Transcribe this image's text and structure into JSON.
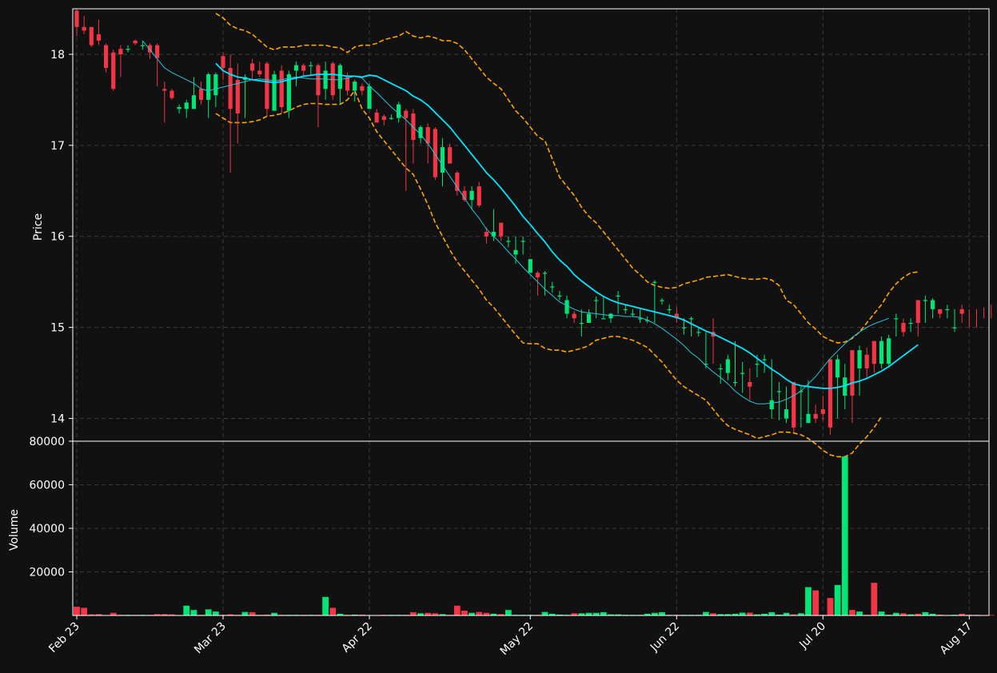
{
  "chart_data": {
    "type": "candlestick",
    "colors": {
      "background": "#111111",
      "up": "#00e676",
      "down": "#f23645",
      "ma_slow": "#00e5ff",
      "ma_fast": "#26c6da",
      "bollinger": "#ffa500",
      "grid": "#3a3a3a",
      "axis": "#ffffff",
      "text": "#ffffff"
    },
    "price_panel": {
      "ylabel": "Price",
      "ylim": [
        13.75,
        18.5
      ],
      "yticks": [
        14,
        15,
        16,
        17,
        18
      ],
      "grid": true
    },
    "volume_panel": {
      "ylabel": "Volume",
      "ylim": [
        0,
        80000
      ],
      "yticks": [
        20000,
        40000,
        60000,
        80000
      ],
      "grid": true
    },
    "x_tick_labels": [
      {
        "label": "Feb 23",
        "index": 0
      },
      {
        "label": "Mar 23",
        "index": 20
      },
      {
        "label": "Apr 22",
        "index": 40
      },
      {
        "label": "May 22",
        "index": 62
      },
      {
        "label": "Jun 22",
        "index": 82
      },
      {
        "label": "Jul 20",
        "index": 102
      },
      {
        "label": "Aug 17",
        "index": 122
      }
    ],
    "candle_count": 126,
    "close": [
      18.3,
      18.26,
      18.1,
      18.15,
      17.85,
      17.62,
      18.0,
      18.06,
      18.12,
      18.1,
      18.02,
      17.96,
      17.6,
      17.52,
      17.42,
      17.47,
      17.55,
      17.5,
      17.78,
      17.78,
      17.85,
      17.4,
      17.35,
      17.75,
      17.82,
      17.78,
      17.4,
      17.78,
      17.42,
      17.78,
      17.88,
      17.82,
      17.88,
      17.55,
      17.82,
      17.55,
      17.88,
      17.6,
      17.7,
      17.6,
      17.65,
      17.25,
      17.28,
      17.3,
      17.45,
      17.3,
      17.06,
      17.2,
      17.02,
      16.65,
      16.98,
      16.8,
      16.5,
      16.4,
      16.5,
      16.34,
      16.0,
      16.05,
      16.0,
      15.95,
      15.85,
      15.95,
      15.75,
      15.55,
      15.6,
      15.45,
      15.35,
      15.3,
      15.1,
      15.05,
      15.15,
      15.3,
      15.1,
      15.15,
      15.35,
      15.2,
      15.15,
      15.1,
      15.08,
      15.5,
      15.3,
      15.2,
      15.1,
      15.0,
      15.1,
      14.95,
      14.6,
      14.9,
      14.55,
      14.65,
      14.4,
      14.5,
      14.35,
      14.6,
      14.65,
      14.2,
      14.3,
      14.1,
      13.9,
      14.3,
      14.05,
      14.0,
      14.05,
      13.9,
      14.65,
      14.45,
      14.25,
      14.75,
      14.55,
      14.6,
      14.85,
      14.88,
      15.1,
      14.95,
      15.05,
      15.05,
      15.3,
      15.3,
      15.15,
      15.2,
      15.0,
      15.15,
      15.15,
      15.1,
      15.2,
      15.2
    ],
    "series": [
      {
        "name": "ohlc_open",
        "values": [
          18.48,
          18.3,
          18.3,
          18.22,
          18.1,
          18.02,
          18.06,
          18.06,
          18.15,
          18.1,
          18.1,
          18.1,
          17.62,
          17.6,
          17.4,
          17.4,
          17.4,
          17.62,
          17.5,
          17.55,
          17.98,
          17.85,
          17.72,
          17.72,
          17.9,
          17.82,
          17.9,
          17.38,
          17.82,
          17.38,
          17.82,
          17.88,
          17.88,
          17.88,
          17.62,
          17.9,
          17.62,
          17.75,
          17.6,
          17.65,
          17.4,
          17.36,
          17.32,
          17.3,
          17.3,
          17.38,
          17.35,
          17.08,
          17.2,
          17.18,
          16.7,
          16.98,
          16.7,
          16.5,
          16.4,
          16.55,
          16.05,
          16.0,
          16.15,
          15.95,
          15.8,
          15.95,
          15.6,
          15.6,
          15.6,
          15.45,
          15.35,
          15.15,
          15.15,
          15.05,
          15.05,
          15.3,
          15.1,
          15.1,
          15.35,
          15.2,
          15.15,
          15.1,
          15.08,
          15.5,
          15.3,
          15.2,
          15.15,
          15.0,
          15.1,
          14.95,
          14.6,
          14.95,
          14.55,
          14.5,
          14.4,
          14.5,
          14.4,
          14.6,
          14.65,
          14.1,
          14.3,
          14.0,
          14.4,
          14.3,
          13.95,
          14.05,
          14.1,
          14.65,
          14.45,
          14.25,
          14.75,
          14.55,
          14.7,
          14.85,
          14.6,
          14.6,
          15.1,
          15.05,
          15.05,
          15.3,
          15.3,
          15.2,
          15.2,
          15.2,
          15.0,
          15.2
        ]
      },
      {
        "name": "ohlc_high",
        "values": [
          18.5,
          18.42,
          18.3,
          18.38,
          18.12,
          18.05,
          18.1,
          18.1,
          18.16,
          18.15,
          18.12,
          18.12,
          17.7,
          17.62,
          17.45,
          17.5,
          17.75,
          17.7,
          17.8,
          17.8,
          18.02,
          18.0,
          17.9,
          17.78,
          17.95,
          17.92,
          17.92,
          17.82,
          17.88,
          17.82,
          17.92,
          17.9,
          17.92,
          17.9,
          17.92,
          17.92,
          17.9,
          17.8,
          17.72,
          17.68,
          17.68,
          17.4,
          17.34,
          17.34,
          17.48,
          17.4,
          17.4,
          17.22,
          17.24,
          17.2,
          17.08,
          17.02,
          16.72,
          16.55,
          16.55,
          16.6,
          16.1,
          16.3,
          16.15,
          16.0,
          16.0,
          16.0,
          15.62,
          15.62,
          15.62,
          15.5,
          15.4,
          15.35,
          15.18,
          15.2,
          15.2,
          15.34,
          15.35,
          15.16,
          15.4,
          15.25,
          15.2,
          15.2,
          15.12,
          15.52,
          15.32,
          15.25,
          15.22,
          15.1,
          15.12,
          15.0,
          14.95,
          15.1,
          14.6,
          14.7,
          14.85,
          14.62,
          14.55,
          14.7,
          14.7,
          14.65,
          14.4,
          14.35,
          14.2,
          14.35,
          14.42,
          14.15,
          14.25,
          14.1,
          14.7,
          14.6,
          14.3,
          14.8,
          14.78,
          14.75,
          14.9,
          14.92,
          15.15,
          15.1,
          15.1,
          15.1,
          15.35,
          15.32,
          15.2,
          15.25,
          15.2,
          15.25,
          15.2,
          15.2,
          15.22,
          15.25
        ]
      },
      {
        "name": "ohlc_low",
        "values": [
          18.2,
          18.22,
          18.08,
          18.1,
          17.8,
          17.6,
          17.75,
          18.02,
          18.1,
          18.05,
          17.95,
          17.65,
          17.25,
          17.5,
          17.35,
          17.3,
          17.4,
          17.45,
          17.3,
          17.42,
          17.72,
          16.7,
          17.02,
          17.3,
          17.72,
          17.75,
          17.32,
          17.38,
          17.35,
          17.3,
          17.65,
          17.75,
          17.78,
          17.2,
          17.5,
          17.5,
          17.45,
          17.55,
          17.48,
          17.55,
          17.58,
          17.28,
          17.22,
          17.28,
          17.25,
          16.5,
          16.8,
          17.02,
          16.8,
          16.62,
          16.55,
          16.8,
          16.45,
          16.38,
          16.3,
          16.32,
          15.92,
          15.95,
          15.95,
          15.88,
          15.7,
          15.8,
          15.7,
          15.35,
          15.35,
          15.38,
          15.3,
          15.1,
          15.05,
          14.9,
          15.05,
          15.1,
          15.1,
          15.05,
          15.15,
          15.15,
          15.12,
          15.05,
          15.05,
          15.05,
          15.25,
          15.15,
          15.05,
          14.92,
          14.9,
          14.9,
          14.55,
          14.6,
          14.38,
          14.42,
          14.35,
          14.28,
          14.2,
          14.45,
          14.5,
          14.0,
          13.98,
          13.95,
          13.85,
          13.9,
          13.95,
          13.95,
          13.98,
          13.82,
          14.0,
          14.1,
          13.95,
          14.25,
          14.45,
          14.5,
          14.55,
          14.58,
          14.9,
          14.9,
          14.95,
          14.9,
          15.05,
          15.1,
          15.1,
          15.1,
          14.95,
          15.05,
          15.0,
          15.0,
          15.1,
          15.1
        ]
      },
      {
        "name": "volume",
        "values": [
          4000,
          3500,
          500,
          600,
          200,
          1200,
          300,
          300,
          300,
          300,
          300,
          600,
          600,
          500,
          200,
          4500,
          2500,
          300,
          2800,
          1800,
          300,
          500,
          300,
          1600,
          1500,
          300,
          400,
          1200,
          300,
          300,
          300,
          300,
          300,
          300,
          8500,
          3500,
          800,
          300,
          400,
          400,
          200,
          200,
          300,
          300,
          300,
          300,
          1500,
          1000,
          1200,
          1000,
          600,
          300,
          4500,
          2200,
          1200,
          1600,
          1200,
          800,
          600,
          2500,
          300,
          300,
          300,
          300,
          1600,
          800,
          400,
          300,
          1000,
          1000,
          1200,
          1200,
          1500,
          500,
          500,
          300,
          300,
          300,
          800,
          1200,
          1500,
          300,
          300,
          300,
          300,
          300,
          1600,
          1000,
          600,
          600,
          800,
          1300,
          1300,
          500,
          800,
          1500,
          400,
          1200,
          500,
          1000,
          13000,
          11500,
          300,
          8000,
          14000,
          73000,
          2500,
          1800,
          300,
          15000,
          1800,
          300,
          1200,
          1000,
          500,
          800,
          1500,
          800,
          400,
          200,
          300,
          800,
          300,
          300,
          200,
          200
        ]
      },
      {
        "name": "ma_slow",
        "values": [
          null,
          null,
          null,
          null,
          null,
          null,
          null,
          null,
          null,
          null,
          null,
          null,
          null,
          null,
          null,
          null,
          null,
          null,
          null,
          17.9,
          17.82,
          17.78,
          17.75,
          17.74,
          17.72,
          17.71,
          17.7,
          17.69,
          17.7,
          17.72,
          17.74,
          17.76,
          17.77,
          17.78,
          17.78,
          17.78,
          17.77,
          17.76,
          17.76,
          17.75,
          17.77,
          17.76,
          17.72,
          17.68,
          17.64,
          17.6,
          17.54,
          17.5,
          17.44,
          17.36,
          17.28,
          17.2,
          17.1,
          17.0,
          16.9,
          16.8,
          16.7,
          16.62,
          16.53,
          16.43,
          16.33,
          16.22,
          16.13,
          16.03,
          15.94,
          15.83,
          15.74,
          15.67,
          15.58,
          15.51,
          15.45,
          15.39,
          15.34,
          15.3,
          15.27,
          15.25,
          15.23,
          15.21,
          15.19,
          15.17,
          15.15,
          15.13,
          15.11,
          15.08,
          15.04,
          15.0,
          14.96,
          14.93,
          14.89,
          14.85,
          14.81,
          14.77,
          14.72,
          14.66,
          14.6,
          14.54,
          14.49,
          14.43,
          14.38,
          14.36,
          14.35,
          14.34,
          14.33,
          14.33,
          14.34,
          14.36,
          14.39,
          14.41,
          14.44,
          14.48,
          14.52,
          14.57,
          14.63,
          14.69,
          14.75,
          14.81
        ]
      },
      {
        "name": "ma_fast",
        "values": [
          null,
          null,
          null,
          null,
          null,
          null,
          null,
          null,
          null,
          18.15,
          18.05,
          17.95,
          17.85,
          17.8,
          17.76,
          17.72,
          17.68,
          17.62,
          17.6,
          17.62,
          17.64,
          17.66,
          17.68,
          17.7,
          17.72,
          17.73,
          17.72,
          17.71,
          17.72,
          17.74,
          17.75,
          17.74,
          17.73,
          17.73,
          17.73,
          17.72,
          17.72,
          17.74,
          17.76,
          17.74,
          17.65,
          17.58,
          17.5,
          17.42,
          17.35,
          17.28,
          17.2,
          17.12,
          17.02,
          16.9,
          16.78,
          16.66,
          16.54,
          16.42,
          16.3,
          16.2,
          16.08,
          16.0,
          15.92,
          15.83,
          15.75,
          15.66,
          15.58,
          15.5,
          15.42,
          15.35,
          15.28,
          15.24,
          15.2,
          15.17,
          15.16,
          15.15,
          15.14,
          15.13,
          15.13,
          15.12,
          15.12,
          15.11,
          15.08,
          15.04,
          14.99,
          14.93,
          14.87,
          14.8,
          14.72,
          14.66,
          14.58,
          14.51,
          14.45,
          14.38,
          14.3,
          14.24,
          14.19,
          14.16,
          14.16,
          14.17,
          14.18,
          14.21,
          14.25,
          14.3,
          14.38,
          14.46,
          14.56,
          14.66,
          14.74,
          14.82,
          14.89,
          14.95,
          15.0,
          15.04,
          15.07,
          15.1
        ]
      },
      {
        "name": "bb_upper",
        "values": [
          null,
          null,
          null,
          null,
          null,
          null,
          null,
          null,
          null,
          null,
          null,
          null,
          null,
          null,
          null,
          null,
          null,
          null,
          null,
          18.45,
          18.4,
          18.32,
          18.28,
          18.26,
          18.22,
          18.15,
          18.08,
          18.05,
          18.08,
          18.08,
          18.08,
          18.1,
          18.1,
          18.1,
          18.1,
          18.08,
          18.07,
          18.02,
          18.08,
          18.1,
          18.1,
          18.12,
          18.16,
          18.18,
          18.2,
          18.25,
          18.2,
          18.18,
          18.2,
          18.18,
          18.15,
          18.15,
          18.12,
          18.05,
          17.95,
          17.85,
          17.75,
          17.68,
          17.62,
          17.5,
          17.38,
          17.3,
          17.2,
          17.1,
          17.05,
          16.85,
          16.65,
          16.55,
          16.45,
          16.32,
          16.22,
          16.15,
          16.05,
          15.95,
          15.85,
          15.75,
          15.65,
          15.58,
          15.5,
          15.46,
          15.44,
          15.43,
          15.44,
          15.48,
          15.5,
          15.52,
          15.55,
          15.56,
          15.57,
          15.58,
          15.56,
          15.54,
          15.53,
          15.53,
          15.54,
          15.52,
          15.46,
          15.3,
          15.25,
          15.15,
          15.05,
          14.98,
          14.9,
          14.86,
          14.83,
          14.84,
          14.88,
          14.95,
          15.05,
          15.15,
          15.25,
          15.38,
          15.48,
          15.55,
          15.6,
          15.61
        ]
      },
      {
        "name": "bb_lower",
        "values": [
          null,
          null,
          null,
          null,
          null,
          null,
          null,
          null,
          null,
          null,
          null,
          null,
          null,
          null,
          null,
          null,
          null,
          null,
          null,
          17.35,
          17.3,
          17.25,
          17.25,
          17.25,
          17.26,
          17.28,
          17.32,
          17.33,
          17.35,
          17.38,
          17.42,
          17.45,
          17.46,
          17.46,
          17.45,
          17.45,
          17.45,
          17.5,
          17.6,
          17.4,
          17.3,
          17.15,
          17.05,
          16.95,
          16.85,
          16.75,
          16.68,
          16.52,
          16.35,
          16.15,
          16.0,
          15.85,
          15.72,
          15.62,
          15.52,
          15.42,
          15.3,
          15.22,
          15.12,
          15.02,
          14.92,
          14.83,
          14.82,
          14.82,
          14.77,
          14.75,
          14.75,
          14.73,
          14.75,
          14.77,
          14.8,
          14.86,
          14.88,
          14.9,
          14.9,
          14.88,
          14.86,
          14.82,
          14.78,
          14.7,
          14.62,
          14.52,
          14.42,
          14.35,
          14.3,
          14.25,
          14.2,
          14.1,
          14.0,
          13.92,
          13.88,
          13.85,
          13.82,
          13.78,
          13.8,
          13.82,
          13.85,
          13.85,
          13.84,
          13.82,
          13.78,
          13.72,
          13.65,
          13.6,
          13.58,
          13.58,
          13.62,
          13.72,
          13.8,
          13.9,
          14.02
        ]
      }
    ]
  }
}
